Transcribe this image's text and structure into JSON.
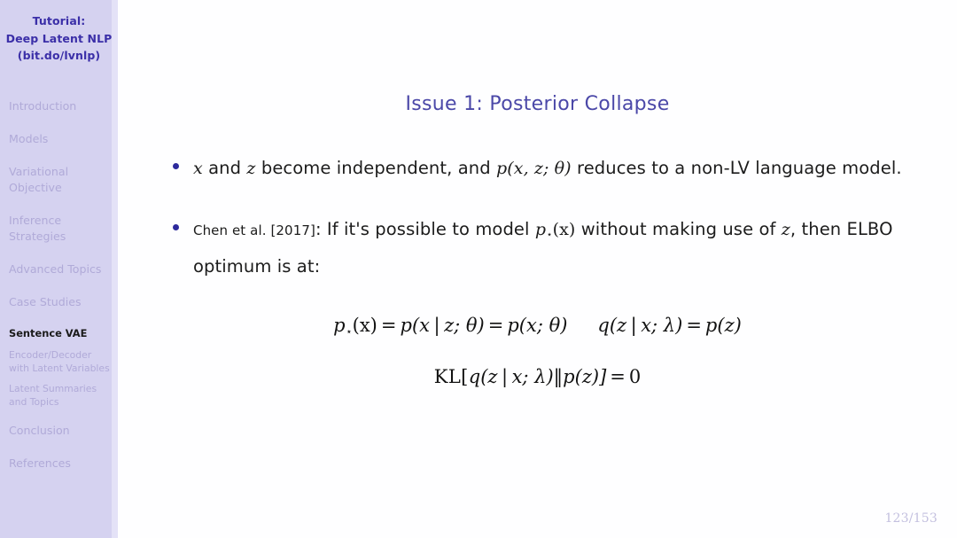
{
  "sidebar": {
    "title_lines": [
      "Tutorial:",
      "Deep Latent NLP",
      "(bit.do/lvnlp)"
    ],
    "sections": [
      {
        "label": "Introduction",
        "current": false
      },
      {
        "label": "Models",
        "current": false
      },
      {
        "label": "Variational Objective",
        "current": false
      },
      {
        "label": "Inference Strategies",
        "current": false
      },
      {
        "label": "Advanced Topics",
        "current": false
      },
      {
        "label": "Case Studies",
        "current": false
      }
    ],
    "subsections": [
      {
        "label": "Sentence VAE",
        "current": true
      },
      {
        "label": "Encoder/Decoder with Latent Variables",
        "current": false
      },
      {
        "label": "Latent Summaries and Topics",
        "current": false
      }
    ],
    "sections_after": [
      {
        "label": "Conclusion",
        "current": false
      },
      {
        "label": "References",
        "current": false
      }
    ]
  },
  "slide": {
    "title": "Issue 1: Posterior Collapse",
    "page_number": "123/153",
    "bullets": [
      {
        "id": "bullet-independence",
        "plain_text": "x and z become independent, and p(x, z; θ) reduces to a non-LV language model.",
        "parts": {
          "x1": "x",
          "and1": " and ",
          "z1": "z",
          "mid": " become independent, and ",
          "p_open": "p",
          "p_args": "(x, z; θ)",
          "tail": " reduces to a non-LV language model."
        }
      },
      {
        "id": "bullet-chen-2017",
        "plain_text": "Chen et al. [2017]: If it's possible to model p⋆(x) without making use of z, then ELBO optimum is at:",
        "parts": {
          "citation": "Chen et al. [2017]",
          "colon": ": ",
          "lead": "If it's possible to model ",
          "p_sym": "p",
          "p_star": "⋆",
          "p_arg": "(x)",
          "mid": " without making use of ",
          "z_sym": "z",
          "tail": ", then ELBO optimum is at:"
        }
      }
    ],
    "equations": [
      {
        "id": "equation-optimum",
        "plain_text": "p⋆(x) = p(x | z; θ) = p(x; θ)     q(z | x; λ) = p(z)",
        "left": {
          "p": "p",
          "star": "⋆",
          "arg": "(x)",
          "eq1": "=",
          "p2": "p",
          "open2": "(x",
          "bar2": "|",
          "zsemi2": "z; θ)",
          "eq2": "=",
          "p3": "p",
          "arg3": "(x; θ)"
        },
        "right": {
          "q": "q",
          "open": "(z",
          "bar": "|",
          "rest": "x; λ)",
          "eq": "=",
          "p": "p",
          "arg": "(z)"
        }
      },
      {
        "id": "equation-kl-zero",
        "plain_text": "KL[q(z | x; λ)‖p(z)] = 0",
        "parts": {
          "kl": "KL[",
          "q": "q",
          "open": "(z",
          "bar": "|",
          "rest": "x; λ)",
          "dbar": "‖",
          "p": "p",
          "parg": "(z)]",
          "eq": "=",
          "zero": "0"
        }
      }
    ]
  },
  "colors": {
    "sidebar_bg": "#d5d2f0",
    "sidebar_edge": "#e4e2f7",
    "sidebar_title": "#3b2fa8",
    "sidebar_item": "#b0aad8",
    "sidebar_current": "#1b1b1b",
    "slide_title": "#4b48a8",
    "bullet_dot": "#2d2a9c",
    "body_text": "#1c1c1c",
    "page_number": "#c3c0df",
    "content_bg": "#fefeff"
  }
}
